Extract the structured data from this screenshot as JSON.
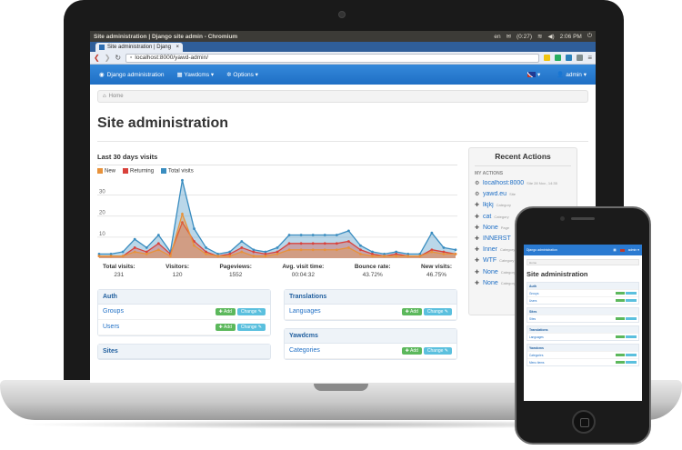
{
  "os": {
    "window_title": "Site administration | Django site admin - Chromium",
    "keyboard": "en",
    "battery": "(0:27)",
    "time": "2:06 PM"
  },
  "browser": {
    "tab_title": "Site administration | Djang",
    "tab_close": "×",
    "url": "localhost:8000/yawd-admin/"
  },
  "navbar": {
    "brand": "Django administration",
    "menu_yawdcms": "Yawdcms ▾",
    "menu_options": "Options ▾",
    "lang": "▾",
    "user": "admin ▾"
  },
  "breadcrumb": {
    "home": "Home"
  },
  "page_title": "Site administration",
  "chart_section_title": "Last 30 days visits",
  "chart_data": {
    "type": "area",
    "title": "Last 30 days visits",
    "series": [
      {
        "name": "New",
        "color": "#e8923a",
        "values": [
          1,
          1,
          1,
          3,
          2,
          4,
          1,
          21,
          6,
          2,
          1,
          1,
          3,
          1,
          1,
          2,
          4,
          4,
          4,
          4,
          4,
          5,
          2,
          1,
          1,
          1,
          1,
          1,
          3,
          2,
          2
        ]
      },
      {
        "name": "Returning",
        "color": "#d9413b",
        "values": [
          1,
          1,
          1,
          5,
          3,
          7,
          2,
          17,
          8,
          3,
          1,
          2,
          5,
          3,
          2,
          3,
          7,
          7,
          7,
          7,
          7,
          8,
          4,
          2,
          1,
          2,
          1,
          1,
          4,
          3,
          2
        ]
      },
      {
        "name": "Total visits",
        "color": "#3a8dc0",
        "values": [
          2,
          2,
          3,
          9,
          5,
          11,
          3,
          37,
          14,
          5,
          2,
          3,
          8,
          4,
          3,
          5,
          11,
          11,
          11,
          11,
          11,
          13,
          6,
          3,
          2,
          3,
          2,
          2,
          12,
          5,
          4
        ]
      }
    ],
    "y_ticks": [
      "30",
      "20",
      "10"
    ],
    "ylim": [
      0,
      38
    ]
  },
  "stats": [
    {
      "label": "Total visits:",
      "value": "231"
    },
    {
      "label": "Visitors:",
      "value": "120"
    },
    {
      "label": "Pageviews:",
      "value": "1552"
    },
    {
      "label": "Avg. visit time:",
      "value": "00:04:32"
    },
    {
      "label": "Bounce rate:",
      "value": "43.72%"
    },
    {
      "label": "New visits:",
      "value": "46.75%"
    }
  ],
  "buttons": {
    "add": "Add",
    "change": "Change"
  },
  "modules_left": [
    {
      "title": "Auth",
      "rows": [
        "Groups",
        "Users"
      ]
    },
    {
      "title": "Sites",
      "rows": []
    }
  ],
  "modules_right": [
    {
      "title": "Translations",
      "rows": [
        "Languages"
      ]
    },
    {
      "title": "Yawdcms",
      "rows": [
        "Categories"
      ]
    }
  ],
  "recent": {
    "title": "Recent Actions",
    "subtitle": "MY ACTIONS",
    "items": [
      {
        "icon": "⚙",
        "label": "localhost:8000",
        "meta": "Site  28 Nov., 14:35"
      },
      {
        "icon": "⚙",
        "label": "yawd.eu",
        "meta": "Site"
      },
      {
        "icon": "✚",
        "label": "lkjkj",
        "meta": "Category"
      },
      {
        "icon": "✚",
        "label": "cat",
        "meta": "Category"
      },
      {
        "icon": "✚",
        "label": "None",
        "meta": "Page"
      },
      {
        "icon": "✚",
        "label": "INNERST",
        "meta": ""
      },
      {
        "icon": "✚",
        "label": "Inner",
        "meta": "Category"
      },
      {
        "icon": "✚",
        "label": "WTF",
        "meta": "Category"
      },
      {
        "icon": "✚",
        "label": "None",
        "meta": "Category"
      },
      {
        "icon": "✚",
        "label": "None",
        "meta": "Category"
      }
    ]
  },
  "phone": {
    "brand": "Django administration",
    "user": "admin ▾",
    "crumb": "Home",
    "title": "Site administration",
    "modules": [
      {
        "title": "Auth",
        "rows": [
          "Groups",
          "Users"
        ]
      },
      {
        "title": "Sites",
        "rows": [
          "Sites"
        ]
      },
      {
        "title": "Translations",
        "rows": [
          "Languages"
        ]
      },
      {
        "title": "Yawdcms",
        "rows": [
          "Categories",
          "Menu items"
        ]
      }
    ]
  }
}
